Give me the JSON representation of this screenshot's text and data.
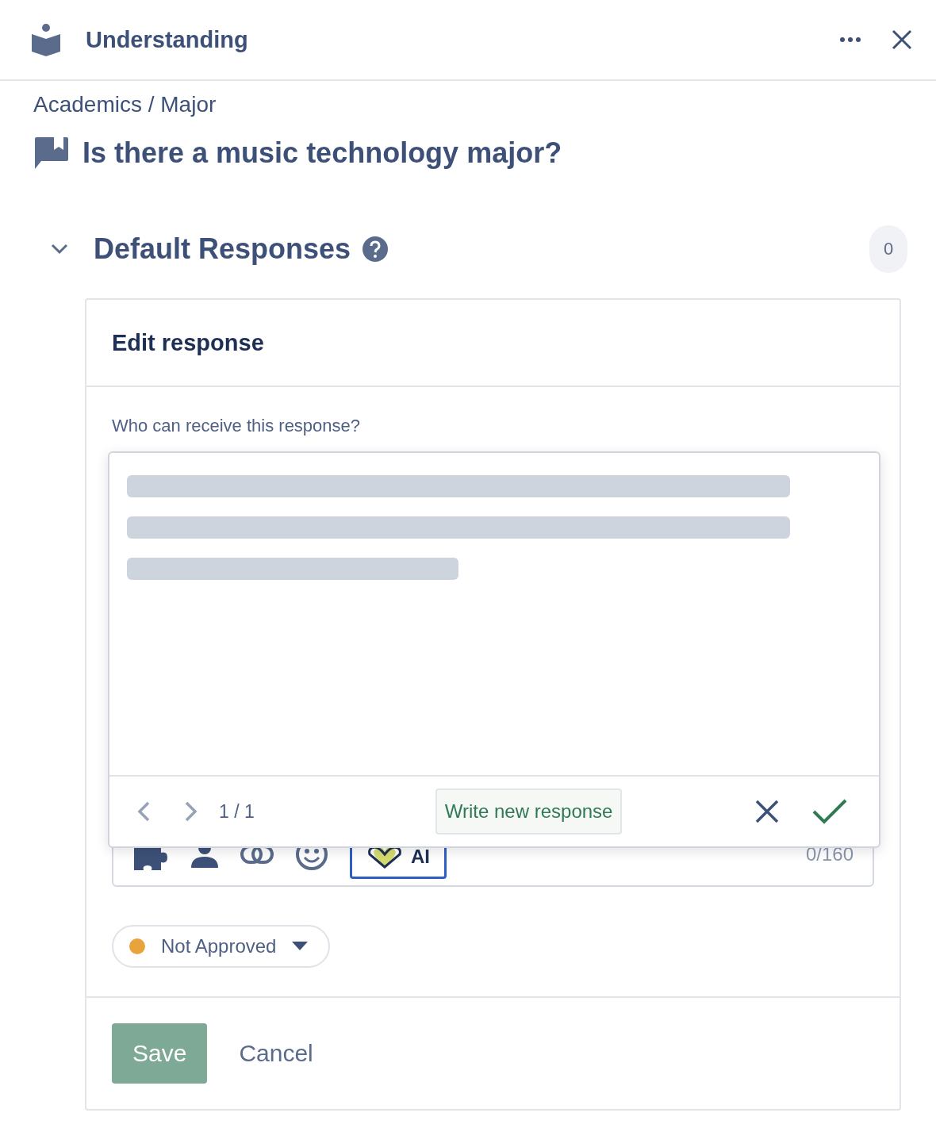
{
  "header": {
    "title": "Understanding"
  },
  "breadcrumb": "Academics / Major",
  "question": "Is there a music technology major?",
  "section": {
    "title": "Default Responses",
    "expanded": true,
    "count": "0"
  },
  "card": {
    "title": "Edit response",
    "audience_label": "Who can receive this response?",
    "editor": {
      "counter": "0/160",
      "ai_label": "AI",
      "ai_active": true
    },
    "suggestion": {
      "pager": "1 / 1",
      "write_new": "Write new response"
    },
    "status": {
      "label": "Not Approved",
      "color": "#e8a33a"
    },
    "save": {
      "label": "Save",
      "disabled": true
    },
    "cancel": "Cancel"
  }
}
